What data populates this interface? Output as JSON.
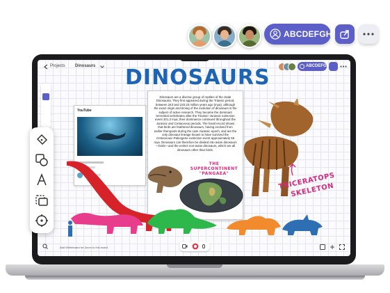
{
  "header": {
    "user_label": "ABCDEFGH",
    "avatars": [
      "user-avatar-1",
      "user-avatar-2",
      "user-avatar-3"
    ]
  },
  "screen": {
    "breadcrumb_back": "Projects",
    "board_name": "Dinosaurs",
    "mini_user_label": "ABCDEFGH",
    "title": "DINOSAURS",
    "note_text": "Dinosaurs are a diverse group of reptiles of the clade Dinosauria. They first appeared during the Triassic period, between 243 and 233.23 million years ago (mya), although the exact origin and timing of the evolution of dinosaurs is the subject of active research. They became the dominant terrestrial vertebrates after the Triassic–Jurassic extinction event 201.3 mya; their dominance continued throughout the Jurassic and Cretaceous periods. The fossil record shows that birds are feathered dinosaurs, having evolved from earlier theropods during the Late Jurassic epoch, and are the only dinosaur lineage known to have survived the Cretaceous–Paleogene extinction event approximately 66 mya. Dinosaurs can therefore be divided into avian dinosaurs—birds—and the extinct non-avian dinosaurs, which are all dinosaurs other than birds.",
    "pangaea_label": "THE SUPERCONTINENT \"PANGAEA\"",
    "triceratops_label_1": "TRICERATOPS",
    "triceratops_label_2": "SKELETON",
    "video_brand": "YouTube",
    "bottom_text": "Add Whiteboard for Zoom to this board"
  },
  "colors": {
    "accent": "#5b5fc7",
    "title": "#1e64b4",
    "handwriting": "#d9287c"
  }
}
